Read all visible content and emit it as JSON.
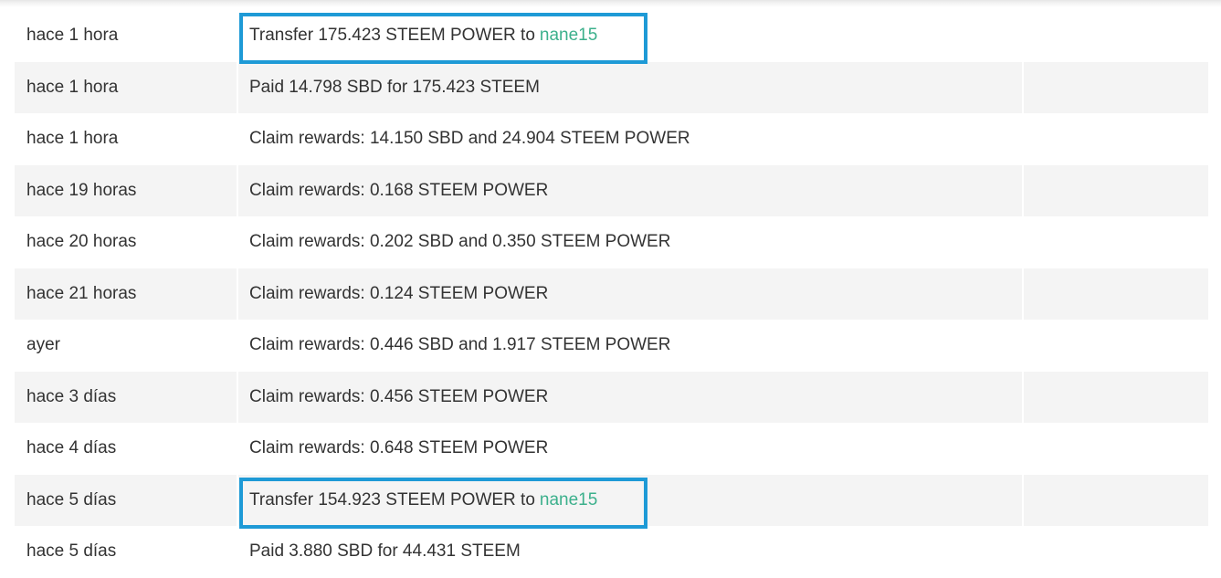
{
  "history": {
    "rows": [
      {
        "date": "hace 1 hora",
        "op": "Transfer 175.423 STEEM POWER to",
        "link": "nane15",
        "memo": ""
      },
      {
        "date": "hace 1 hora",
        "op": "Paid 14.798 SBD for 175.423 STEEM",
        "link": "",
        "memo": ""
      },
      {
        "date": "hace 1 hora",
        "op": "Claim rewards: 14.150 SBD and 24.904 STEEM POWER",
        "link": "",
        "memo": ""
      },
      {
        "date": "hace 19 horas",
        "op": "Claim rewards: 0.168 STEEM POWER",
        "link": "",
        "memo": ""
      },
      {
        "date": "hace 20 horas",
        "op": "Claim rewards: 0.202 SBD and 0.350 STEEM POWER",
        "link": "",
        "memo": ""
      },
      {
        "date": "hace 21 horas",
        "op": "Claim rewards: 0.124 STEEM POWER",
        "link": "",
        "memo": ""
      },
      {
        "date": "ayer",
        "op": "Claim rewards: 0.446 SBD and 1.917 STEEM POWER",
        "link": "",
        "memo": ""
      },
      {
        "date": "hace 3 días",
        "op": "Claim rewards: 0.456 STEEM POWER",
        "link": "",
        "memo": ""
      },
      {
        "date": "hace 4 días",
        "op": "Claim rewards: 0.648 STEEM POWER",
        "link": "",
        "memo": ""
      },
      {
        "date": "hace 5 días",
        "op": "Transfer 154.923 STEEM POWER to",
        "link": "nane15",
        "memo": ""
      },
      {
        "date": "hace 5 días",
        "op": "Paid 3.880 SBD for 44.431 STEEM",
        "link": "",
        "memo": ""
      }
    ]
  },
  "colors": {
    "link": "#3cb08c",
    "highlight_border": "#1e9ad6",
    "alt_row": "#f4f4f4",
    "text": "#333333"
  }
}
